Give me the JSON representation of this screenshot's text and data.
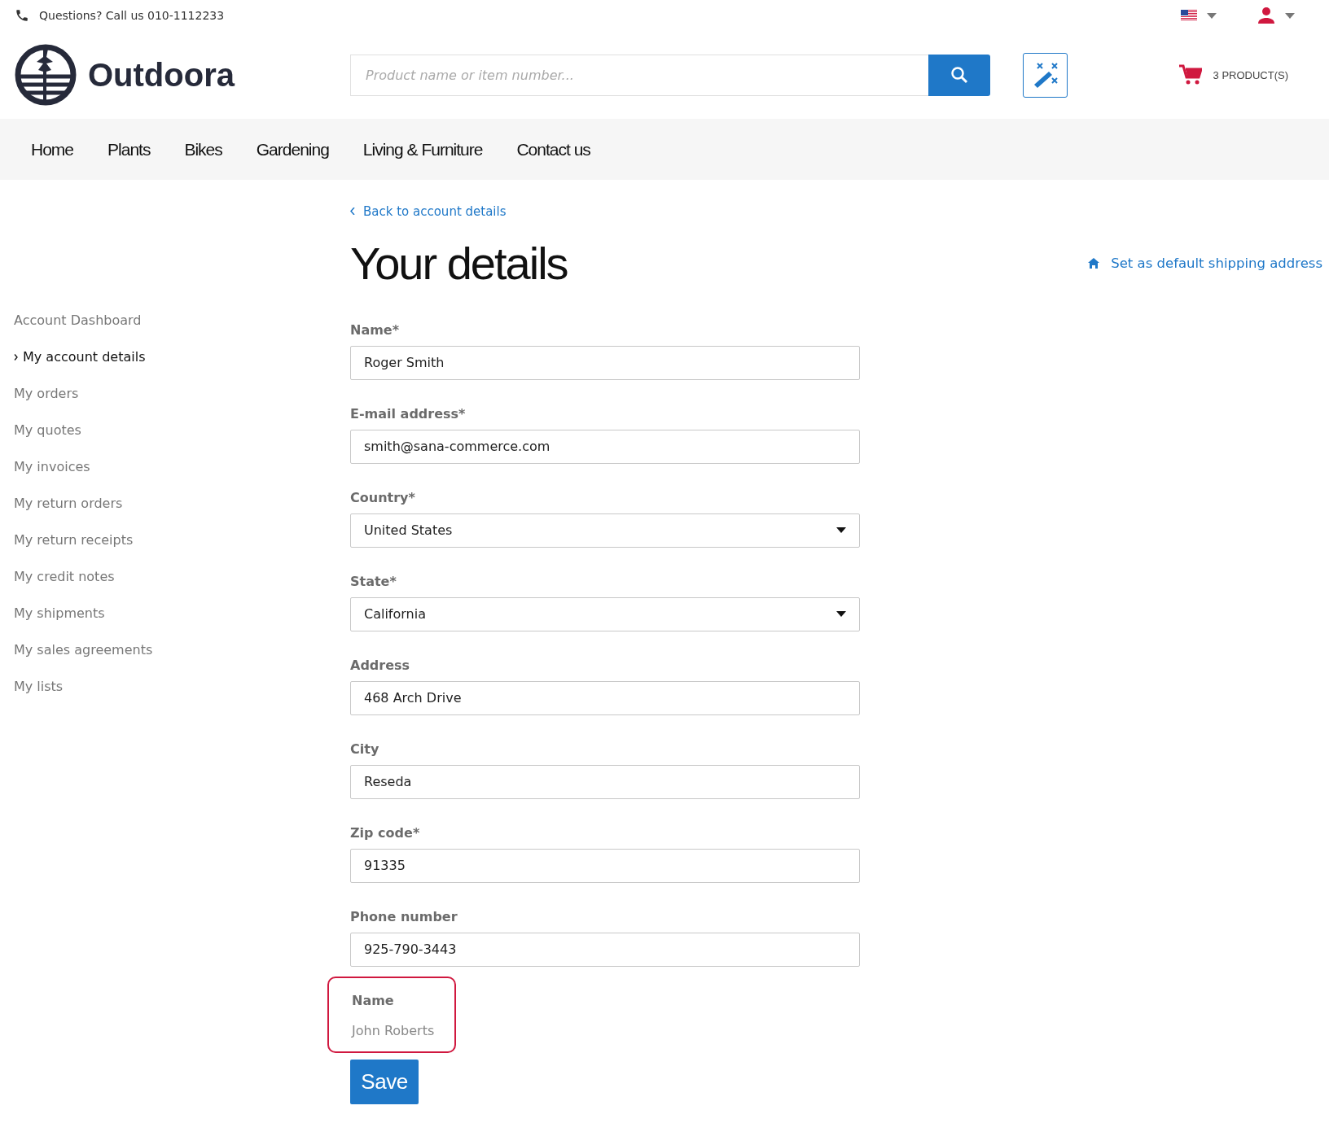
{
  "top_bar": {
    "contact": "Questions? Call us 010-1112233"
  },
  "header": {
    "logo_text": "Outdoora",
    "search": {
      "placeholder": "Product name or item number..."
    },
    "cart": {
      "label": "3 PRODUCT(S)"
    }
  },
  "nav": [
    {
      "label": "Home"
    },
    {
      "label": "Plants"
    },
    {
      "label": "Bikes"
    },
    {
      "label": "Gardening"
    },
    {
      "label": "Living & Furniture"
    },
    {
      "label": "Contact us"
    }
  ],
  "sidebar": {
    "items": [
      {
        "label": "Account Dashboard",
        "selected": false
      },
      {
        "label": "My account details",
        "selected": true
      },
      {
        "label": "My orders",
        "selected": false
      },
      {
        "label": "My quotes",
        "selected": false
      },
      {
        "label": "My invoices",
        "selected": false
      },
      {
        "label": "My return orders",
        "selected": false
      },
      {
        "label": "My return receipts",
        "selected": false
      },
      {
        "label": "My credit notes",
        "selected": false
      },
      {
        "label": "My shipments",
        "selected": false
      },
      {
        "label": "My sales agreements",
        "selected": false
      },
      {
        "label": "My lists",
        "selected": false
      }
    ]
  },
  "back_link": "Back to account details",
  "title": "Your details",
  "default_shipping_link": "Set as default shipping address",
  "form": {
    "fields": [
      {
        "label": "Name*",
        "kind": "text",
        "value": "Roger Smith"
      },
      {
        "label": "E-mail address*",
        "kind": "text",
        "value": "smith@sana-commerce.com"
      },
      {
        "label": "Country*",
        "kind": "select",
        "value": "United States"
      },
      {
        "label": "State*",
        "kind": "select",
        "value": "California"
      },
      {
        "label": "Address",
        "kind": "text",
        "value": "468 Arch Drive"
      },
      {
        "label": "City",
        "kind": "text",
        "value": "Reseda"
      },
      {
        "label": "Zip code*",
        "kind": "text",
        "value": "91335"
      },
      {
        "label": "Phone number",
        "kind": "text",
        "value": "925-790-3443"
      }
    ],
    "readonly_field": {
      "label": "Name",
      "value": "John Roberts",
      "highlighted": true
    },
    "save_button": "Save"
  }
}
